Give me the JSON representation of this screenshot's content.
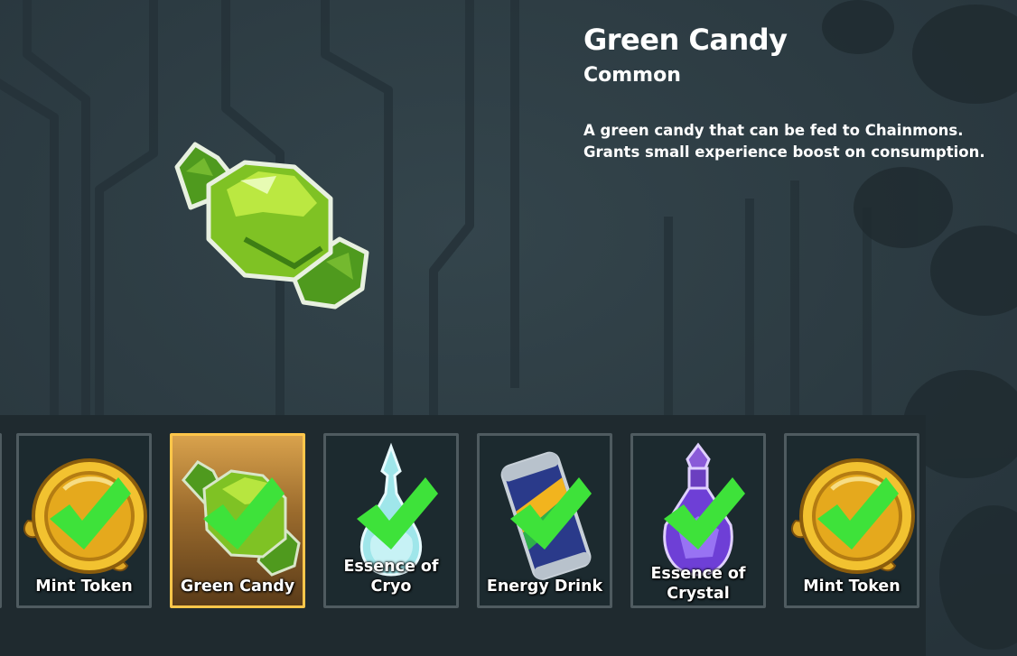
{
  "colors": {
    "background": "#2d3b41",
    "strip": "#1f2a2f",
    "slot_border": "#4f5b60",
    "selected_border": "#ffc64a",
    "check": "#3ee23a",
    "text": "#ffffff"
  },
  "detail": {
    "name": "Green Candy",
    "rarity": "Common",
    "description": "A green candy that can be fed to Chainmons. Grants small experience boost on consumption.",
    "icon": "green-candy-icon"
  },
  "inventory": [
    {
      "label": "Mint Token",
      "icon": "mint-token-icon",
      "selected": false,
      "checked": true
    },
    {
      "label": "Green Candy",
      "icon": "green-candy-icon",
      "selected": true,
      "checked": true
    },
    {
      "label": "Essence of Cryo",
      "icon": "essence-of-cryo-icon",
      "selected": false,
      "checked": true
    },
    {
      "label": "Energy Drink",
      "icon": "energy-drink-icon",
      "selected": false,
      "checked": true
    },
    {
      "label": "Essence of Crystal",
      "icon": "essence-of-crystal-icon",
      "selected": false,
      "checked": true
    },
    {
      "label": "Mint Token",
      "icon": "mint-token-icon",
      "selected": false,
      "checked": true
    }
  ]
}
